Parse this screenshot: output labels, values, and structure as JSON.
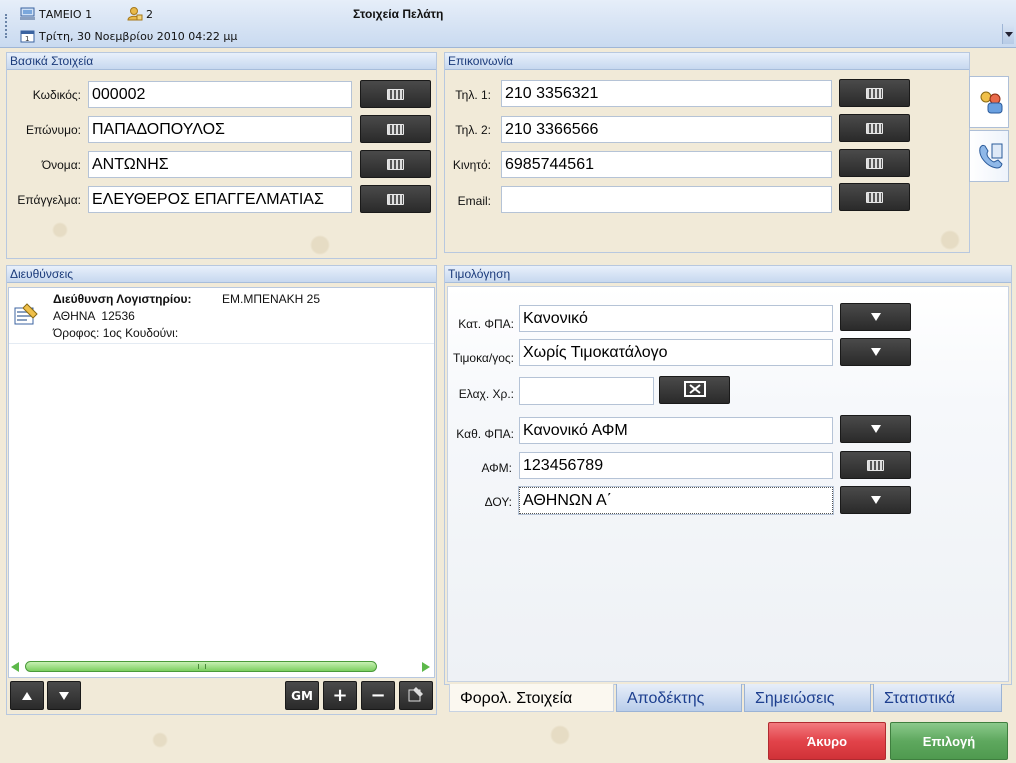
{
  "header": {
    "register_label": "ΤΑΜΕΙΟ 1",
    "user_count": "2",
    "title": "Στοιχεία Πελάτη",
    "datetime": "Τρίτη, 30 Νοεμβρίου 2010 04:22 μμ"
  },
  "basic": {
    "title": "Βασικά Στοιχεία",
    "code_label": "Κωδικός:",
    "code_value": "000002",
    "surname_label": "Επώνυμο:",
    "surname_value": "ΠΑΠΑΔΟΠΟΥΛΟΣ",
    "name_label": "Όνομα:",
    "name_value": "ΑΝΤΩΝΗΣ",
    "profession_label": "Επάγγελμα:",
    "profession_value": "ΕΛΕΥΘΕΡΟΣ ΕΠΑΓΓΕΛΜΑΤΙΑΣ"
  },
  "contact": {
    "title": "Επικοινωνία",
    "phone1_label": "Τηλ. 1:",
    "phone1_value": "210 3356321",
    "phone2_label": "Τηλ. 2:",
    "phone2_value": "210 3366566",
    "mobile_label": "Κινητό:",
    "mobile_value": "6985744561",
    "email_label": "Email:",
    "email_value": ""
  },
  "addresses": {
    "title": "Διευθύνσεις",
    "items": [
      {
        "type_label": "Διεύθυνση Λογιστηρίου:",
        "street": "ΕΜ.ΜΠΕΝΑΚΗ 25",
        "city_line": "ΑΘΗΝΑ  12536",
        "floor_line": "Όροφος: 1ος Κουδούνι:"
      }
    ],
    "gm_label": "GM",
    "plus_label": "+",
    "minus_label": "−"
  },
  "billing": {
    "title": "Τιμολόγηση",
    "vat_cat_label": "Κατ. ΦΠΑ:",
    "vat_cat_value": "Κανονικό",
    "pricelist_label": "Τιμοκα/γος:",
    "pricelist_value": "Χωρίς Τιμοκατάλογο",
    "min_charge_label": "Ελαχ. Χρ.:",
    "min_charge_value": "",
    "vat_status_label": "Καθ. ΦΠΑ:",
    "vat_status_value": "Κανονικό ΑΦΜ",
    "afm_label": "ΑΦΜ:",
    "afm_value": "123456789",
    "doy_label": "ΔΟΥ:",
    "doy_value": "ΑΘΗΝΩΝ Α΄"
  },
  "tabs": [
    "Φορολ. Στοιχεία",
    "Αποδέκτης",
    "Σημειώσεις",
    "Στατιστικά"
  ],
  "actions": {
    "cancel_label": "Άκυρο",
    "select_label": "Επιλογή"
  },
  "colors": {
    "cancel": "#e2434a",
    "select": "#5ea85e",
    "panel_header_text": "#1a3a7a"
  }
}
